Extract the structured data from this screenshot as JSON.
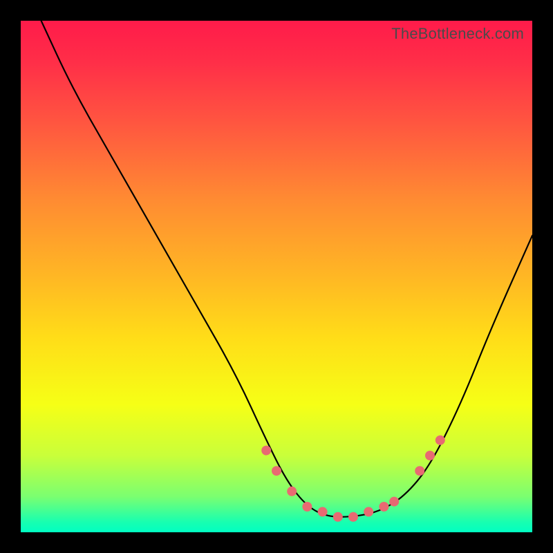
{
  "attribution": "TheBottleneck.com",
  "chart_data": {
    "type": "line",
    "title": "",
    "xlabel": "",
    "ylabel": "",
    "xlim": [
      0,
      100
    ],
    "ylim": [
      0,
      100
    ],
    "grid": false,
    "legend": false,
    "note": "V-shaped bottleneck curve over red-to-green vertical gradient; values are approximate pixel-read estimates on a 0–100 normalized scale",
    "series": [
      {
        "name": "bottleneck-curve",
        "x": [
          4,
          10,
          18,
          26,
          34,
          42,
          48,
          52,
          56,
          60,
          65,
          70,
          75,
          80,
          86,
          92,
          100
        ],
        "y": [
          100,
          87,
          73,
          59,
          45,
          31,
          18,
          10,
          5,
          3,
          3,
          4,
          7,
          13,
          25,
          40,
          58
        ]
      }
    ],
    "markers": {
      "name": "highlight-points",
      "color": "#e86a72",
      "x": [
        48,
        50,
        53,
        56,
        59,
        62,
        65,
        68,
        71,
        73,
        78,
        80,
        82
      ],
      "y": [
        16,
        12,
        8,
        5,
        4,
        3,
        3,
        4,
        5,
        6,
        12,
        15,
        18
      ]
    }
  }
}
